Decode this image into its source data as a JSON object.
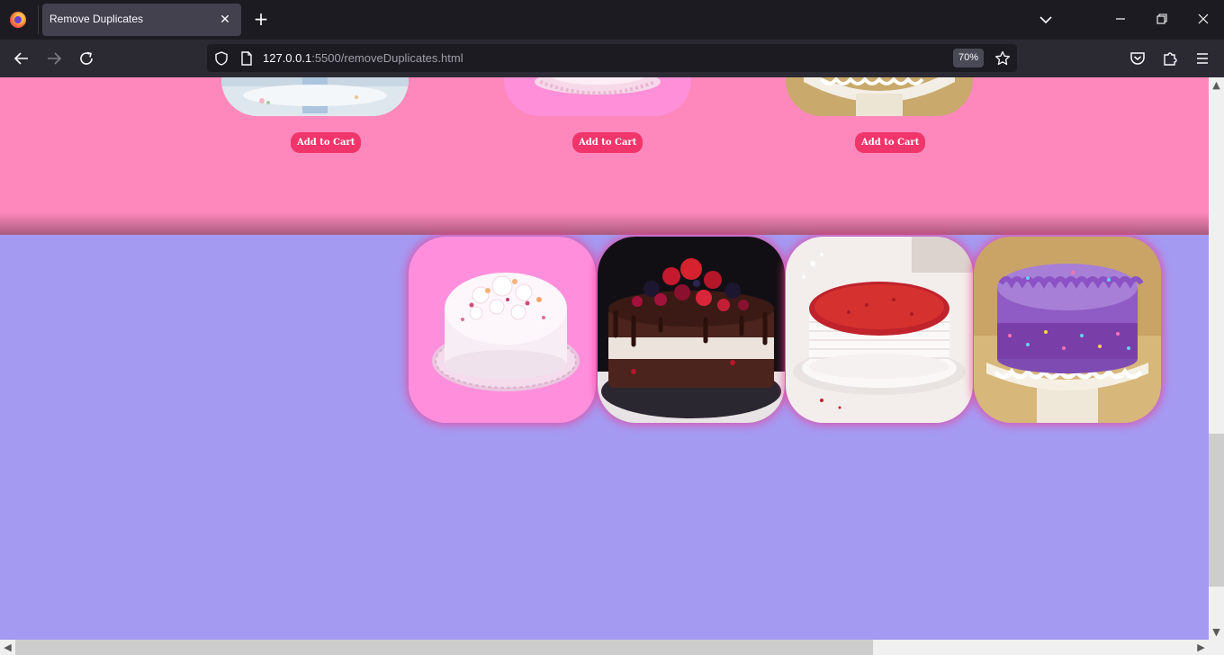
{
  "browser": {
    "tab_title": "Remove Duplicates",
    "url_host": "127.0.0.1",
    "url_rest": ":5500/removeDuplicates.html",
    "zoom": "70%"
  },
  "page": {
    "colors": {
      "pink_bg": "#fe88bc",
      "purple_bg": "#a59af2",
      "button": "#f0356b"
    },
    "top_row": [
      {
        "icon": "white-cake-partial",
        "cart_label": "Add to Cart"
      },
      {
        "icon": "pink-cake-partial",
        "cart_label": "Add to Cart"
      },
      {
        "icon": "purple-cake-partial",
        "cart_label": "Add to Cart"
      }
    ],
    "bottom_row": [
      {
        "icon": "white-cream-cake"
      },
      {
        "icon": "chocolate-berry-cake"
      },
      {
        "icon": "red-velvet-cake"
      },
      {
        "icon": "purple-sprinkle-cake"
      }
    ]
  }
}
